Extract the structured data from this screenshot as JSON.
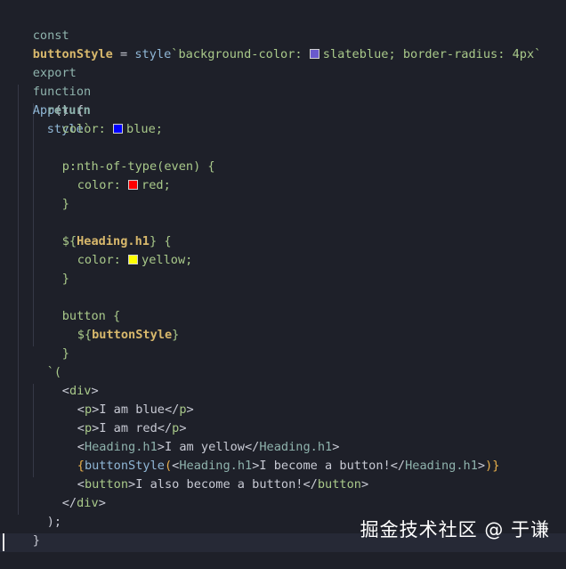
{
  "code": {
    "l1": {
      "kw": "const",
      "name": "buttonStyle",
      "eq": " = ",
      "fn": "style",
      "tick": "`",
      "prop": "background-color: ",
      "color_name": "slateblue",
      "rest": "; border-radius: 4px`"
    },
    "l2": {
      "kw": "export",
      "kw2": "function",
      "fn": "App",
      "rest": "() {"
    },
    "l3": {
      "kw": "return",
      "fn": "style",
      "tick": "`"
    },
    "l4": {
      "prop": "color: ",
      "value": "blue;"
    },
    "l5": {
      "selector": "p:nth-of-type(even) {"
    },
    "l6": {
      "prop": "color: ",
      "value": "red;"
    },
    "l7": {
      "close": "}"
    },
    "l8": {
      "open": "${",
      "ident": "Heading.h1",
      "close": "} {"
    },
    "l9": {
      "prop": "color: ",
      "value": "yellow;"
    },
    "l10": {
      "close": "}"
    },
    "l11": {
      "selector": "button {"
    },
    "l12": {
      "open": "${",
      "ident": "buttonStyle",
      "close": "}"
    },
    "l13": {
      "close": "}"
    },
    "l14": {
      "text": "`("
    },
    "l15": {
      "lt": "<",
      "tag": "div",
      "gt": ">"
    },
    "l16": {
      "open": "<",
      "tag": "p",
      "gt": ">",
      "text": "I am blue",
      "close_open": "</",
      "close_tag": "p",
      "close_gt": ">"
    },
    "l17": {
      "open": "<",
      "tag": "p",
      "gt": ">",
      "text": "I am red",
      "close_open": "</",
      "close_tag": "p",
      "close_gt": ">"
    },
    "l18": {
      "open": "<",
      "tag": "Heading.h1",
      "gt": ">",
      "text": "I am yellow",
      "close_open": "</",
      "close_tag": "Heading.h1",
      "close_gt": ">"
    },
    "l19": {
      "brace": "{",
      "fn": "buttonStyle",
      "paren": "(",
      "open": "<",
      "tag": "Heading.h1",
      "gt": ">",
      "text": "I become a button!",
      "close_open": "</",
      "close_tag": "Heading.h1",
      "close_gt": ">",
      "end": ")}"
    },
    "l20": {
      "open": "<",
      "tag": "button",
      "gt": ">",
      "text": "I also become a button!",
      "close_open": "</",
      "close_tag": "button",
      "close_gt": ">"
    },
    "l21": {
      "lt": "</",
      "tag": "div",
      "gt": ">"
    },
    "l22": {
      "text": ");"
    },
    "l23": {
      "text": "}"
    }
  },
  "colors": {
    "slateblue": "#6a5acd",
    "blue": "#0000ff",
    "red": "#ff0000",
    "yellow": "#ffff00"
  },
  "watermark": "掘金技术社区 @ 于谦"
}
